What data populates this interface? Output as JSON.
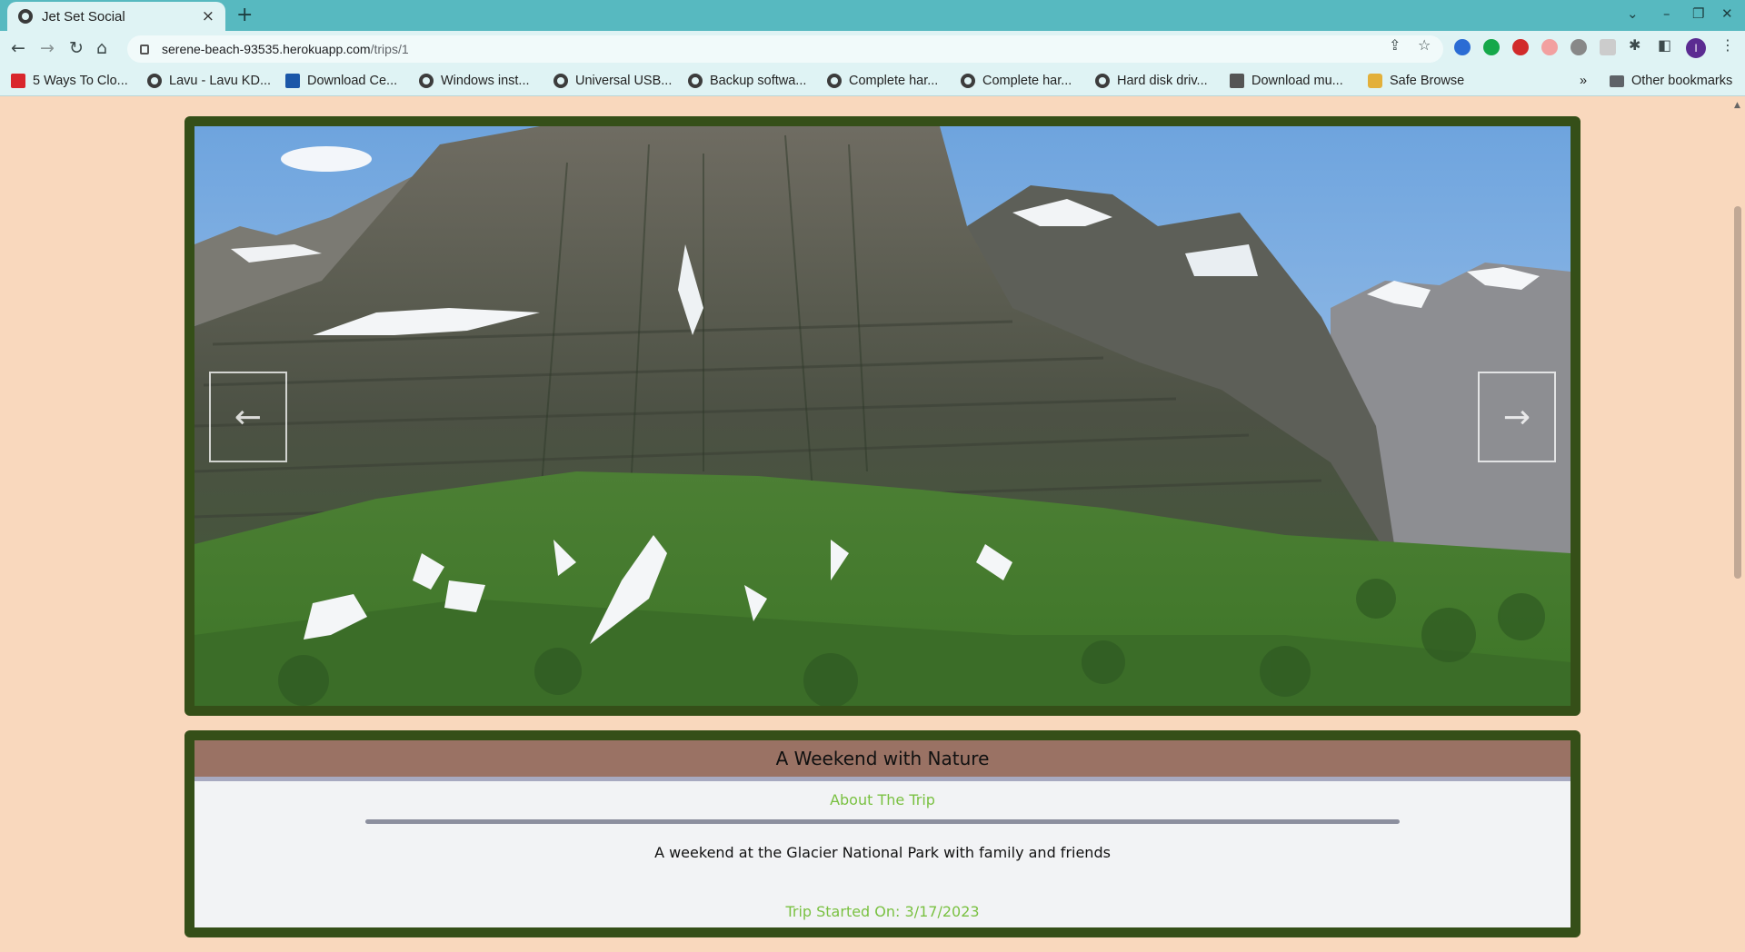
{
  "browser": {
    "tab_title": "Jet Set Social",
    "tab_close": "×",
    "new_tab": "+",
    "url_host": "serene-beach-93535.herokuapp.com",
    "url_path": "/trips/1",
    "profile_initial": "I",
    "bookmarks": [
      {
        "label": "5 Ways To Clo...",
        "icon": "red"
      },
      {
        "label": "Lavu - Lavu KD...",
        "icon": "globe"
      },
      {
        "label": "Download Ce...",
        "icon": "blue"
      },
      {
        "label": "Windows inst...",
        "icon": "globe"
      },
      {
        "label": "Universal USB...",
        "icon": "globe"
      },
      {
        "label": "Backup softwa...",
        "icon": "globe"
      },
      {
        "label": "Complete har...",
        "icon": "globe"
      },
      {
        "label": "Complete har...",
        "icon": "globe"
      },
      {
        "label": "Hard disk driv...",
        "icon": "globe"
      },
      {
        "label": "Download mu...",
        "icon": "gray"
      },
      {
        "label": "Safe Browse",
        "icon": "yellow"
      }
    ],
    "bookmarks_overflow": "»",
    "other_bookmarks": "Other bookmarks"
  },
  "carousel": {
    "prev_label": "←",
    "next_label": "→"
  },
  "trip": {
    "title": "A Weekend with Nature",
    "section_label": "About The Trip",
    "description": "A weekend at the Glacier National Park with family and friends",
    "started": "Trip Started On: 3/17/2023"
  },
  "colors": {
    "page_bg": "#f9d8bd",
    "card_border": "#354f18",
    "header_bg": "#9a7264",
    "accent_green": "#7ac142"
  }
}
